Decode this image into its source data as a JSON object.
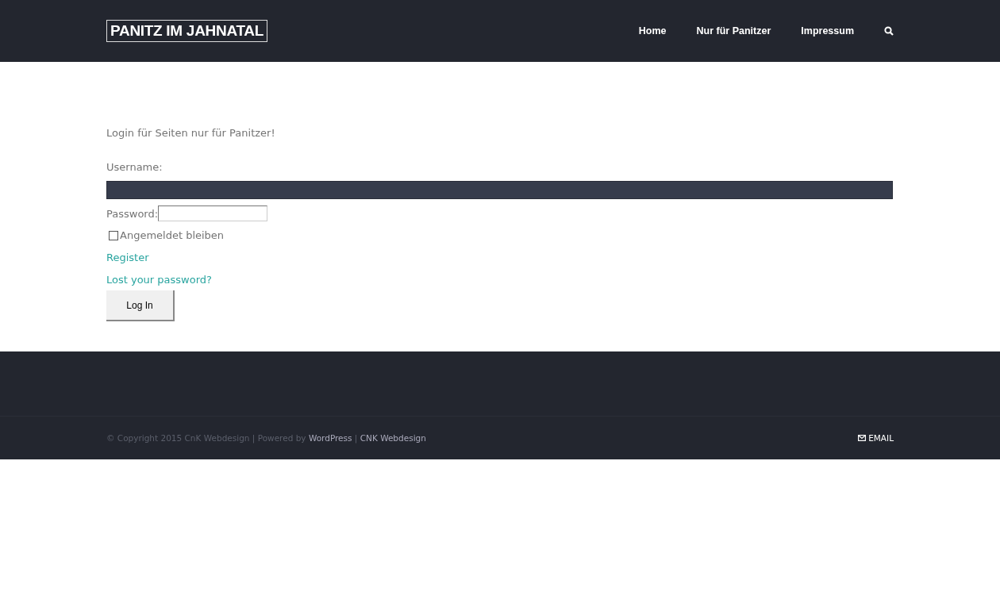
{
  "header": {
    "logo": "PANITZ IM JAHNATAL",
    "nav": [
      {
        "label": "Home"
      },
      {
        "label": "Nur für Panitzer"
      },
      {
        "label": "Impressum"
      }
    ]
  },
  "content": {
    "intro": "Login für Seiten nur für Panitzer!",
    "username_label": "Username:",
    "password_label": "Password:",
    "remember": {
      "label": "Angemeldet bleiben",
      "checked": false
    },
    "links": [
      "Register",
      "Lost your password?"
    ],
    "submit": "Log In"
  },
  "footer": {
    "copyright": "© Copyright 2015 CnK Webdesign | Powered by ",
    "links": [
      {
        "label": "WordPress"
      },
      {
        "label": "CNK Webdesign"
      }
    ],
    "separator": " | ",
    "email": "EMAIL"
  }
}
